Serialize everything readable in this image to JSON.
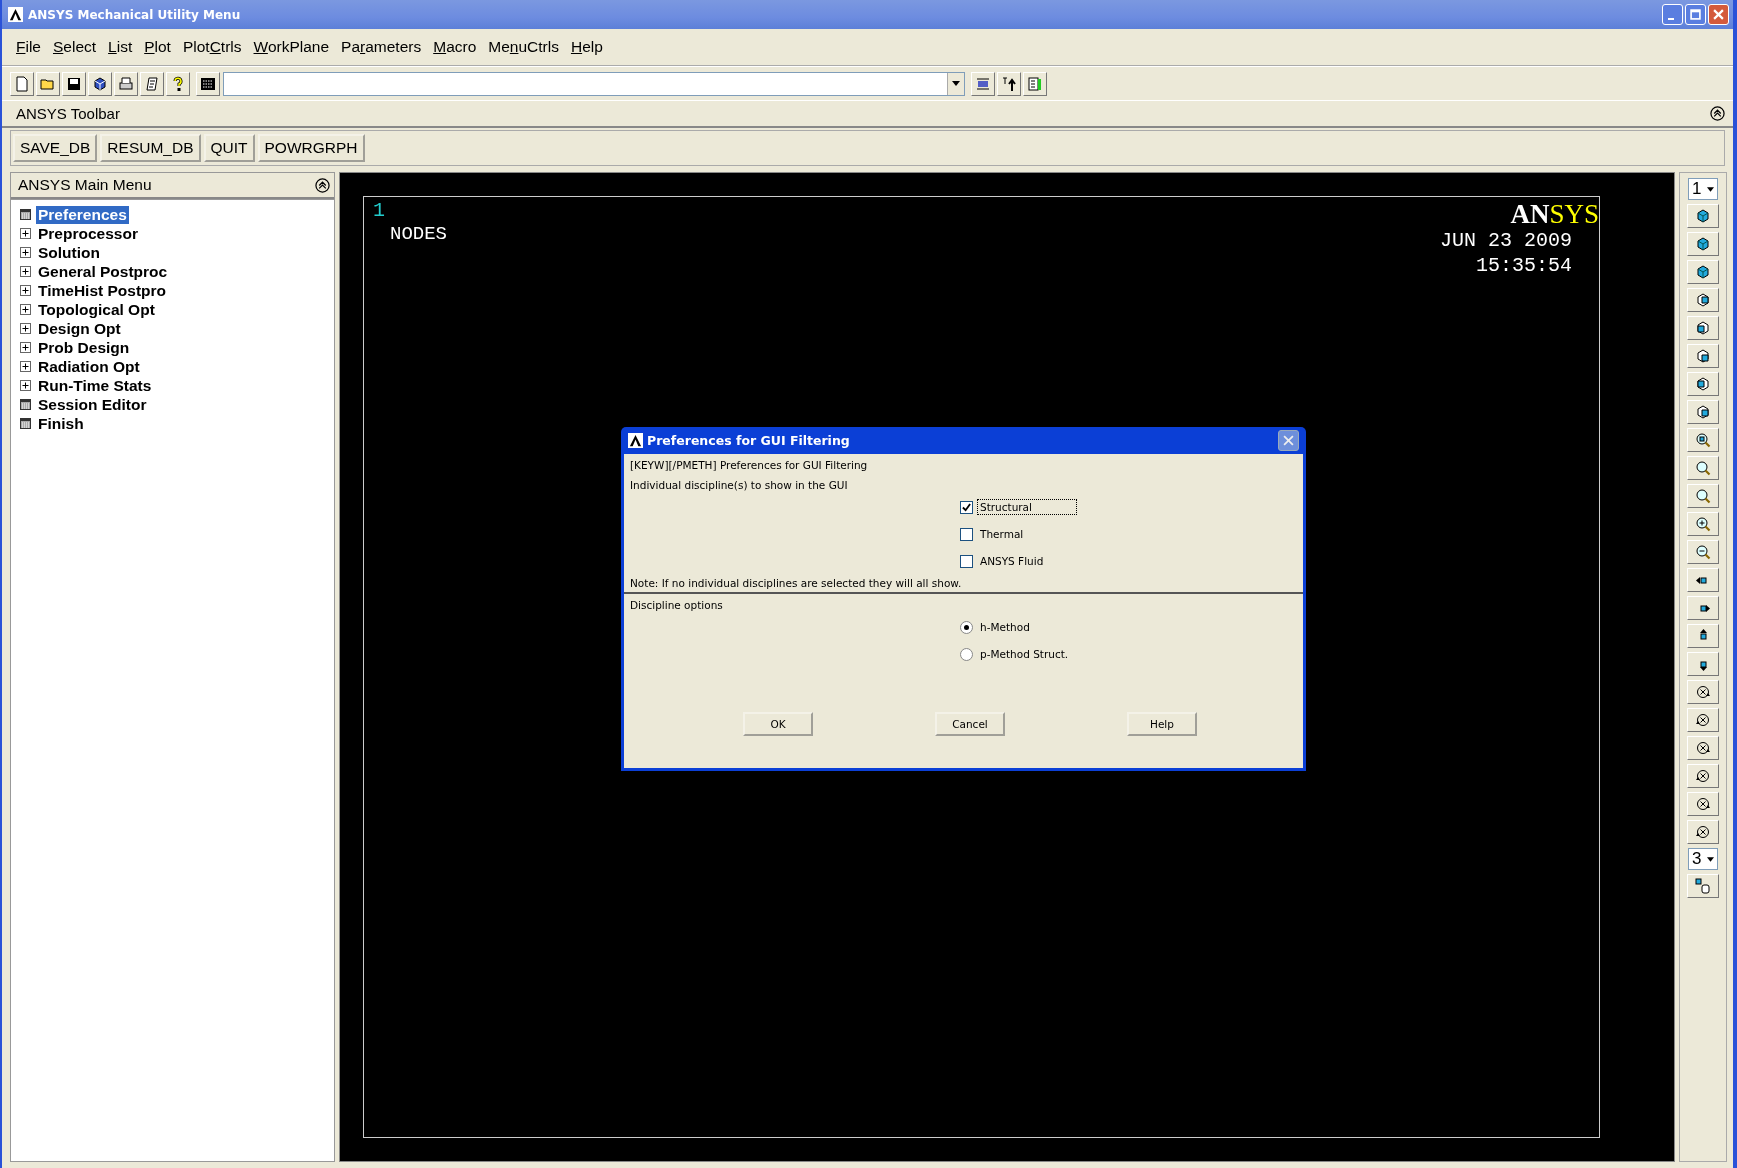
{
  "window": {
    "title": "ANSYS Mechanical Utility Menu"
  },
  "menu_bar": [
    {
      "key": "F",
      "after": "ile"
    },
    {
      "key": "S",
      "after": "elect"
    },
    {
      "key": "L",
      "after": "ist"
    },
    {
      "key": "P",
      "after": "lot"
    },
    {
      "before": "Plot",
      "key": "C",
      "after": "trls"
    },
    {
      "key": "W",
      "after": "orkPlane"
    },
    {
      "before": "Pa",
      "key": "r",
      "after": "ameters"
    },
    {
      "key": "M",
      "after": "acro"
    },
    {
      "before": "Me",
      "key": "n",
      "after": "uCtrls"
    },
    {
      "key": "H",
      "after": "elp"
    }
  ],
  "toolbar": {
    "title": "ANSYS Toolbar",
    "buttons": [
      "SAVE_DB",
      "RESUM_DB",
      "QUIT",
      "POWRGRPH"
    ]
  },
  "main_menu": {
    "title": "ANSYS Main Menu",
    "items": [
      {
        "label": "Preferences",
        "kind": "leaf",
        "selected": true
      },
      {
        "label": "Preprocessor",
        "kind": "branch",
        "expanded": false,
        "selected": false
      },
      {
        "label": "Solution",
        "kind": "branch",
        "expanded": false,
        "selected": false
      },
      {
        "label": "General Postproc",
        "kind": "branch",
        "expanded": false,
        "selected": false
      },
      {
        "label": "TimeHist Postpro",
        "kind": "branch",
        "expanded": false,
        "selected": false
      },
      {
        "label": "Topological Opt",
        "kind": "branch",
        "expanded": false,
        "selected": false
      },
      {
        "label": "Design Opt",
        "kind": "branch",
        "expanded": false,
        "selected": false
      },
      {
        "label": "Prob Design",
        "kind": "branch",
        "expanded": false,
        "selected": false
      },
      {
        "label": "Radiation Opt",
        "kind": "branch",
        "expanded": false,
        "selected": false
      },
      {
        "label": "Run-Time Stats",
        "kind": "branch",
        "expanded": false,
        "selected": false
      },
      {
        "label": "Session Editor",
        "kind": "leaf",
        "selected": false
      },
      {
        "label": "Finish",
        "kind": "leaf",
        "selected": false
      }
    ]
  },
  "graphics": {
    "window_number": "1",
    "plot_label": "NODES",
    "logo": [
      "AN",
      "SYS"
    ],
    "date": "JUN 23 2009",
    "time": "15:35:54"
  },
  "view_toolbar": {
    "window_select": "1",
    "rotation_increment": "3"
  },
  "dialog": {
    "title": "Preferences for GUI Filtering",
    "command": "[KEYW][/PMETH] Preferences for GUI Filtering",
    "prompt": "Individual discipline(s) to show in the GUI",
    "disciplines": [
      {
        "label": "Structural",
        "checked": true,
        "focused": true
      },
      {
        "label": "Thermal",
        "checked": false,
        "focused": false
      },
      {
        "label": "ANSYS Fluid",
        "checked": false,
        "focused": false
      }
    ],
    "note": "Note: If no individual disciplines are selected they will all show.",
    "options_title": "Discipline options",
    "methods": [
      {
        "label": "h-Method",
        "selected": true
      },
      {
        "label": "p-Method Struct.",
        "selected": false
      }
    ],
    "buttons": [
      "OK",
      "Cancel",
      "Help"
    ]
  }
}
